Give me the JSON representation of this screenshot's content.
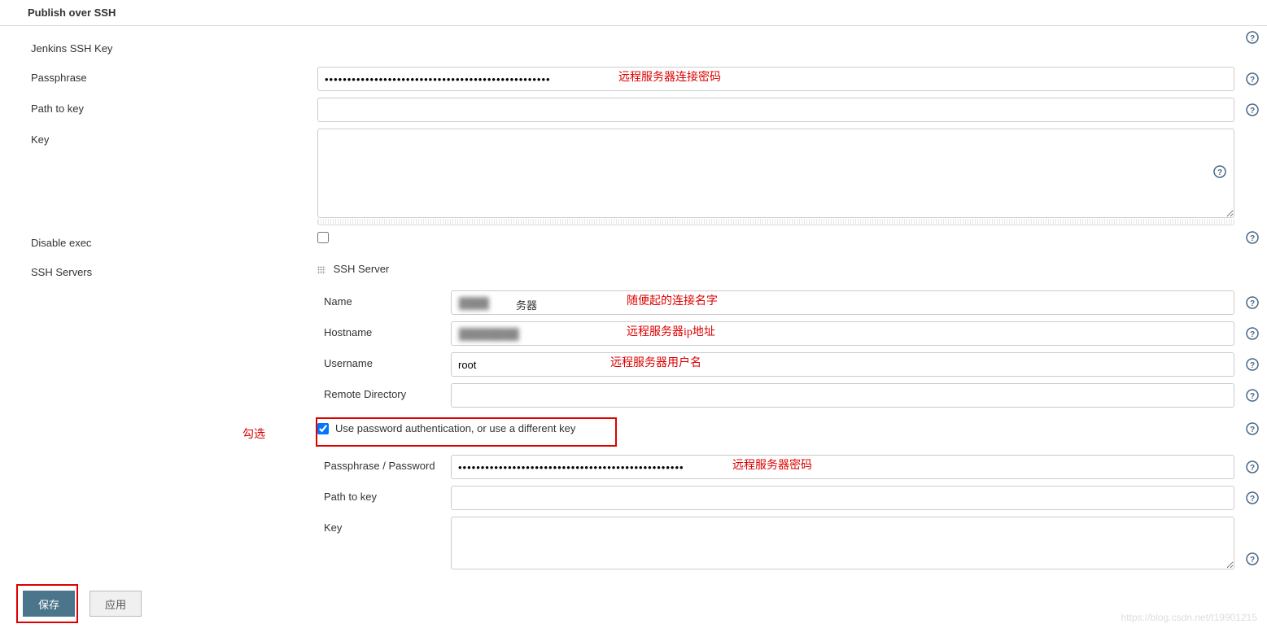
{
  "section": {
    "title": "Publish over SSH"
  },
  "labels": {
    "jenkins_ssh_key": "Jenkins SSH Key",
    "passphrase": "Passphrase",
    "path_to_key": "Path to key",
    "key": "Key",
    "disable_exec": "Disable exec",
    "ssh_servers": "SSH Servers",
    "ssh_server": "SSH Server",
    "name": "Name",
    "hostname": "Hostname",
    "username": "Username",
    "remote_directory": "Remote Directory",
    "use_password_auth": "Use password authentication, or use a different key",
    "passphrase_password": "Passphrase / Password",
    "path_to_key2": "Path to key",
    "key2": "Key"
  },
  "values": {
    "passphrase": "••••••••••••••••••••••••••••••••••••••••••••••••••",
    "path_to_key": "",
    "key": "",
    "disable_exec_checked": false,
    "name": "务器",
    "hostname": "",
    "username": "root",
    "remote_directory": "",
    "use_password_auth_checked": true,
    "passphrase_password": "••••••••••••••••••••••••••••••••••••••••••••••••••",
    "path_to_key2": "",
    "key2": ""
  },
  "annotations": {
    "passphrase_note": "远程服务器连接密码",
    "name_note": "随便起的连接名字",
    "hostname_note": "远程服务器ip地址",
    "username_note": "远程服务器用户名",
    "check_note": "勾选",
    "password_note": "远程服务器密码"
  },
  "footer": {
    "save": "保存",
    "apply": "应用"
  },
  "watermark": "https://blog.csdn.net/t19901215"
}
